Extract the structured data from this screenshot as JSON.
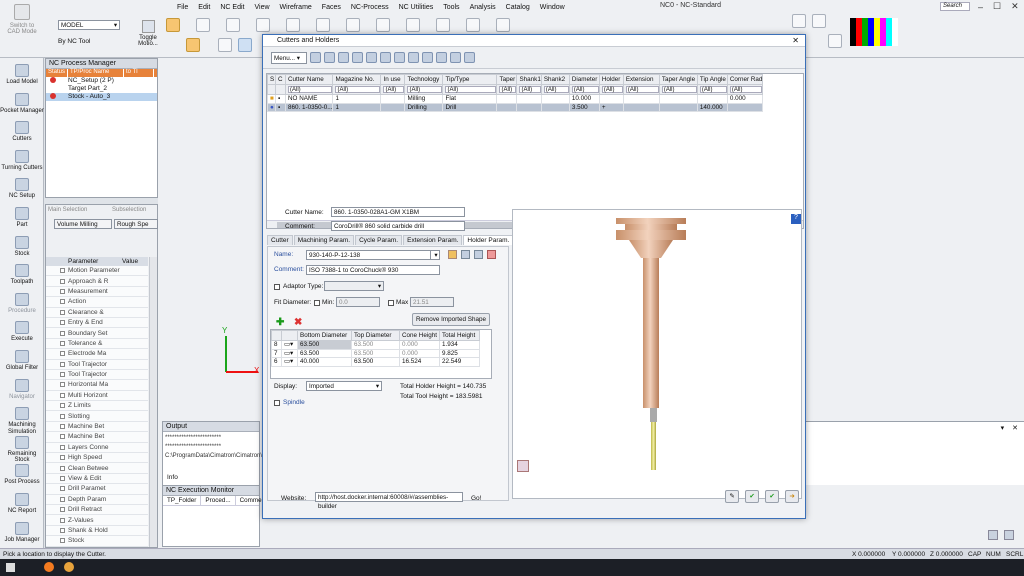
{
  "window": {
    "title": "NC0 - NC-Standard",
    "search_placeholder": "Search"
  },
  "menu": [
    "File",
    "Edit",
    "NC Edit",
    "View",
    "Wireframe",
    "Faces",
    "NC-Process",
    "NC Utilities",
    "Tools",
    "Analysis",
    "Catalog",
    "Window"
  ],
  "ribbon": {
    "switch_label": "Switch to CAD Mode",
    "model_select": "MODEL",
    "by_nc_tool": "By NC Tool",
    "toggle_motion": "Toggle Motio..."
  },
  "left_toolbar": [
    {
      "label": "Load Model",
      "dim": false
    },
    {
      "label": "Pocket Manager",
      "dim": false
    },
    {
      "label": "Cutters",
      "dim": false
    },
    {
      "label": "Turning Cutters",
      "dim": false
    },
    {
      "label": "NC Setup",
      "dim": false
    },
    {
      "label": "Part",
      "dim": false
    },
    {
      "label": "Stock",
      "dim": false
    },
    {
      "label": "Toolpath",
      "dim": false
    },
    {
      "label": "Procedure",
      "dim": true
    },
    {
      "label": "Execute",
      "dim": false
    },
    {
      "label": "Global Filter",
      "dim": false
    },
    {
      "label": "Navigator",
      "dim": true
    },
    {
      "label": "Machining Simulation",
      "dim": false
    },
    {
      "label": "Remaining Stock",
      "dim": false
    },
    {
      "label": "Post Process",
      "dim": false
    },
    {
      "label": "NC Report",
      "dim": false
    },
    {
      "label": "Job Manager",
      "dim": false
    }
  ],
  "process_manager": {
    "title": "NC Process Manager",
    "columns": [
      "Status",
      "TP/Proc Name",
      "to Tl"
    ],
    "rows": [
      {
        "name": "NC_Setup (2 P)",
        "status": "x",
        "selected": false
      },
      {
        "name": "Target Part_2",
        "status": "",
        "selected": false
      },
      {
        "name": "Stock - Auto_3",
        "status": "x",
        "selected": true
      }
    ]
  },
  "main_selection": {
    "label": "Main Selection",
    "value": "Volume Milling",
    "sub_label": "Subselection",
    "sub_value": "Rough Spe"
  },
  "parameters": {
    "col_param": "Parameter",
    "col_value": "Value",
    "rows": [
      "Motion Parameter",
      "Approach & R",
      "Measurement",
      "Action",
      "Clearance &",
      "Entry & End",
      "Boundary Set",
      "Tolerance &",
      "Electrode Ma",
      "Tool Trajector",
      "Tool Trajector",
      "Horizontal Ma",
      "Multi Horizont",
      "Z Limits",
      "Slotting",
      "Machine Bet",
      "Machine Bet",
      "Layers Conne",
      "High Speed",
      "Clean Betwee",
      "View & Edit",
      "Drill Paramet",
      "Depth Param",
      "Drill Retract",
      "Z-Values",
      "Shank & Hold",
      "Stock"
    ]
  },
  "output": {
    "title": "Output",
    "lines": [
      "************************",
      "************************",
      "C:\\ProgramData\\Cimatron\\Cimatron\\1"
    ],
    "tab": "Info"
  },
  "exec_monitor": {
    "title": "NC Execution Monitor",
    "columns": [
      "TP_Folder",
      "Proced...",
      "Comme"
    ]
  },
  "status_bar": {
    "hint": "Pick a location to display the Cutter.",
    "x": "X 0.000000",
    "y": "Y 0.000000",
    "z": "Z 0.000000",
    "caps": "CAP",
    "num": "NUM",
    "scrl": "SCRL"
  },
  "axes": {
    "y": "Y",
    "x": "X"
  },
  "dialog": {
    "title": "Cutters and Holders",
    "menu_button": "Menu...",
    "grid_columns": [
      "S",
      "C",
      "Cutter Name",
      "Magazine No.",
      "In use",
      "Technology",
      "Tip/Type",
      "Taper",
      "Shank1",
      "Shank2",
      "Diameter",
      "Holder",
      "Extension",
      "Taper Angle",
      "Tip Angle",
      "Corner Rad"
    ],
    "filter_value": "(All)",
    "grid_rows": [
      {
        "s": "x",
        "name": "NO NAME",
        "mag": "1",
        "inuse": "",
        "tech": "Milling",
        "tip": "Flat",
        "taper": "",
        "shank1": "",
        "shank2": "",
        "dia": "10.000",
        "holder": "",
        "ext": "",
        "tangle": "",
        "tipangle": "",
        "corner": "0.000",
        "selected": false
      },
      {
        "s": "o",
        "name": "860. 1-0350-0...",
        "mag": "1",
        "inuse": "",
        "tech": "Drilling",
        "tip": "Drill",
        "taper": "",
        "shank1": "",
        "shank2": "",
        "dia": "3.500",
        "holder": "+",
        "ext": "",
        "tangle": "",
        "tipangle": "140.000",
        "corner": "",
        "selected": true
      }
    ],
    "cutter_name_label": "Cutter Name:",
    "cutter_name": "860. 1-0350-028A1-GM X1BM",
    "comment_label": "Comment:",
    "comment": "CoroDrill® 860 solid carbide drill",
    "tabs": [
      "Cutter",
      "Machining Param.",
      "Cycle Param.",
      "Extension Param.",
      "Holder Param."
    ],
    "active_tab": "Holder Param.",
    "holder_name_label": "Name:",
    "holder_name": "930-140-P-12-138",
    "holder_comment_label": "Comment:",
    "holder_comment": "ISO 7388-1 to CoroChuck® 930",
    "adaptor_label": "Adaptor Type:",
    "fit_label": "Fit Diameter:",
    "min_label": "Min:",
    "min_value": "0.0",
    "max_label": "Max",
    "max_value": "21.51",
    "remove_btn": "Remove Imported Shape",
    "seg_columns": [
      "",
      "",
      "Bottom Diameter",
      "Top Diameter",
      "Cone Height",
      "Total Height"
    ],
    "segments": [
      {
        "n": "8",
        "bottom": "63.500",
        "top": "63.500",
        "cone": "0.000",
        "total": "1.934"
      },
      {
        "n": "7",
        "bottom": "63.500",
        "top": "63.500",
        "cone": "0.000",
        "total": "9.825"
      },
      {
        "n": "6",
        "bottom": "40.000",
        "top": "63.500",
        "cone": "16.524",
        "total": "22.549"
      }
    ],
    "display_label": "Display:",
    "display_value": "Imported",
    "total_holder": "Total Holder Height = 140.735",
    "total_tool": "Total Tool Height = 183.5981",
    "spindle_label": "Spindle",
    "website_label": "Website:",
    "website": "http://host.docker.internal:60008/#/assemblies-builder",
    "go": "Go!"
  },
  "colors": {
    "accent_orange": "#e7823a",
    "holder_copper": "#dcae8c",
    "drill_yellow": "#e9e37a",
    "selection": "#b8c2d1"
  }
}
